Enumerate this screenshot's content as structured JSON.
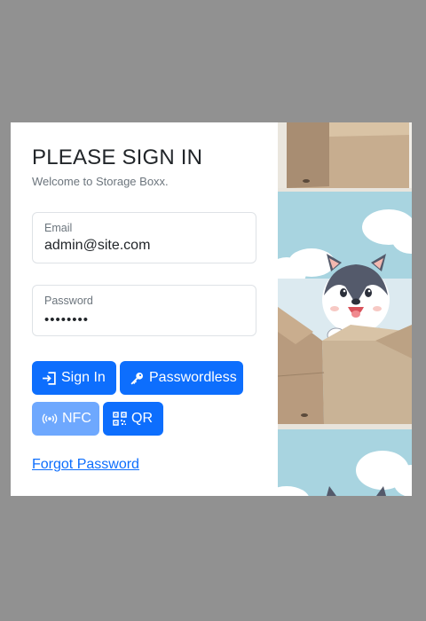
{
  "login": {
    "title": "PLEASE SIGN IN",
    "subtitle": "Welcome to Storage Boxx.",
    "email": {
      "label": "Email",
      "value": "admin@site.com"
    },
    "password": {
      "label": "Password",
      "value": "••••••••"
    },
    "buttons": {
      "sign_in": "Sign In",
      "passwordless": "Passwordless",
      "nfc": "NFC",
      "qr": "QR"
    },
    "forgot_password": "Forgot Password"
  },
  "colors": {
    "primary": "#0d6efd",
    "primary_disabled": "#6ea8fe",
    "backdrop": "#919191"
  },
  "icons": [
    "sign-in-icon",
    "key-icon",
    "nfc-icon",
    "qr-icon",
    "husky-in-box-illustration"
  ]
}
